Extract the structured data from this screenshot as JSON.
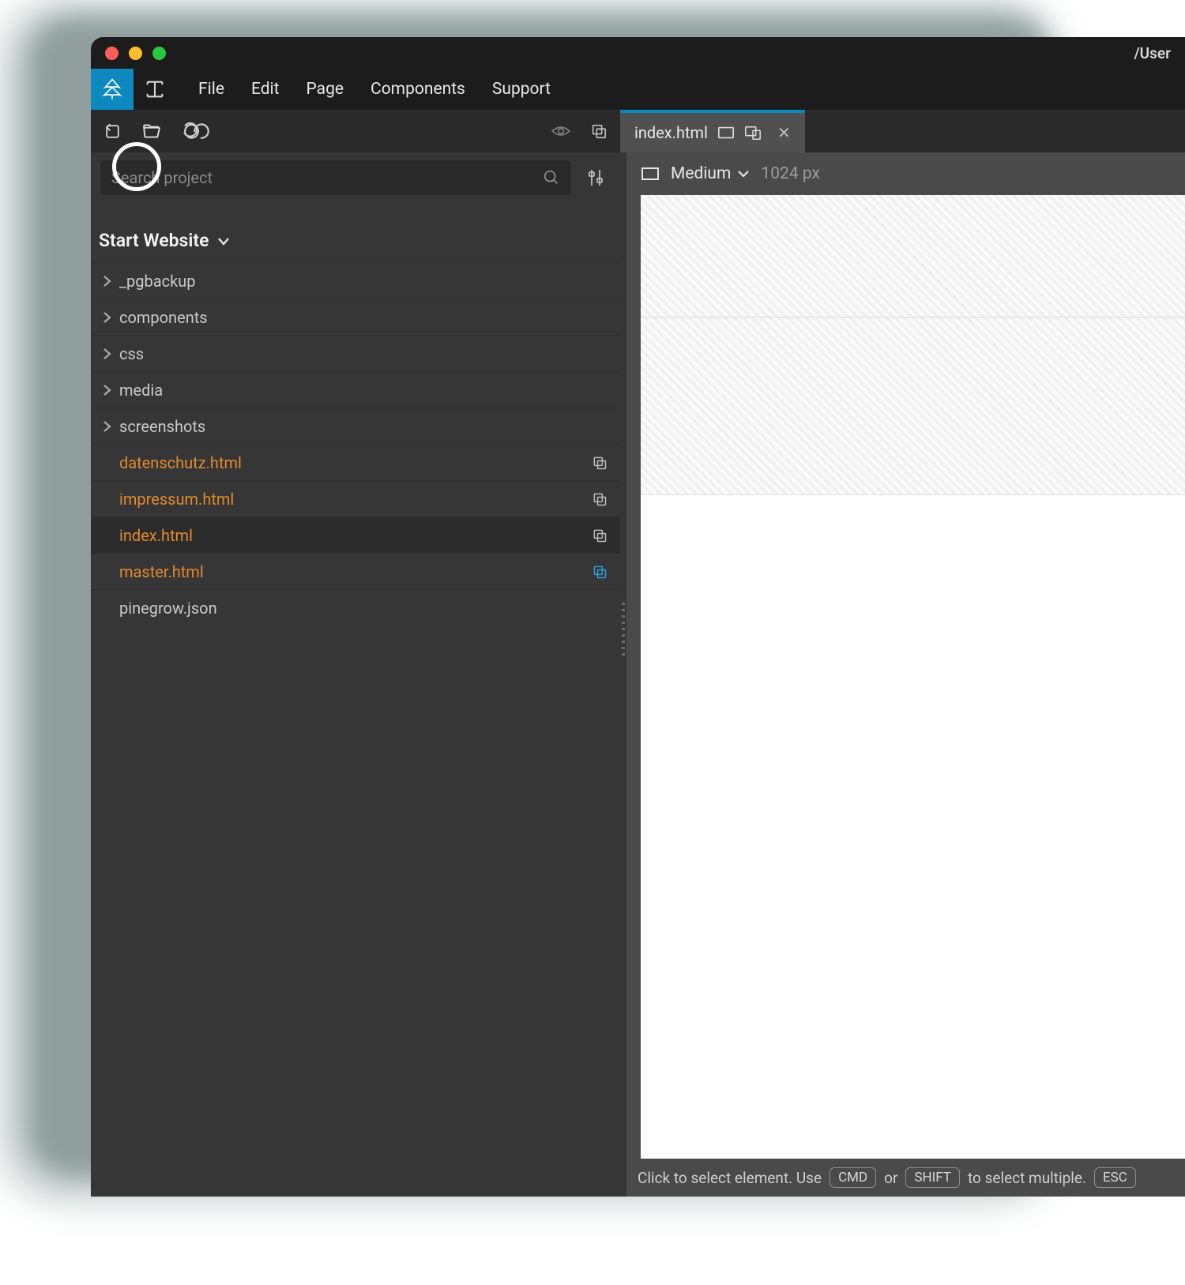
{
  "titlebar": {
    "path": "/User"
  },
  "menu": {
    "items": [
      "File",
      "Edit",
      "Page",
      "Components",
      "Support"
    ]
  },
  "tabs": {
    "active": {
      "label": "index.html"
    }
  },
  "search": {
    "placeholder": "Search project"
  },
  "project": {
    "name": "Start Website"
  },
  "tree": {
    "folders": [
      "_pgbackup",
      "components",
      "css",
      "media",
      "screenshots"
    ],
    "files": [
      {
        "name": "datenschutz.html",
        "modified": true,
        "active": false,
        "componentIcon": "gray"
      },
      {
        "name": "impressum.html",
        "modified": true,
        "active": false,
        "componentIcon": "gray"
      },
      {
        "name": "index.html",
        "modified": true,
        "active": true,
        "componentIcon": "gray"
      },
      {
        "name": "master.html",
        "modified": true,
        "active": false,
        "componentIcon": "blue"
      },
      {
        "name": "pinegrow.json",
        "modified": false,
        "active": false,
        "componentIcon": ""
      }
    ]
  },
  "editor": {
    "breakpoint": "Medium",
    "widthLabel": "1024 px"
  },
  "status": {
    "pre": "Click to select element. Use",
    "k1": "CMD",
    "mid": "or",
    "k2": "SHIFT",
    "post": "to select multiple.",
    "k3": "ESC"
  }
}
